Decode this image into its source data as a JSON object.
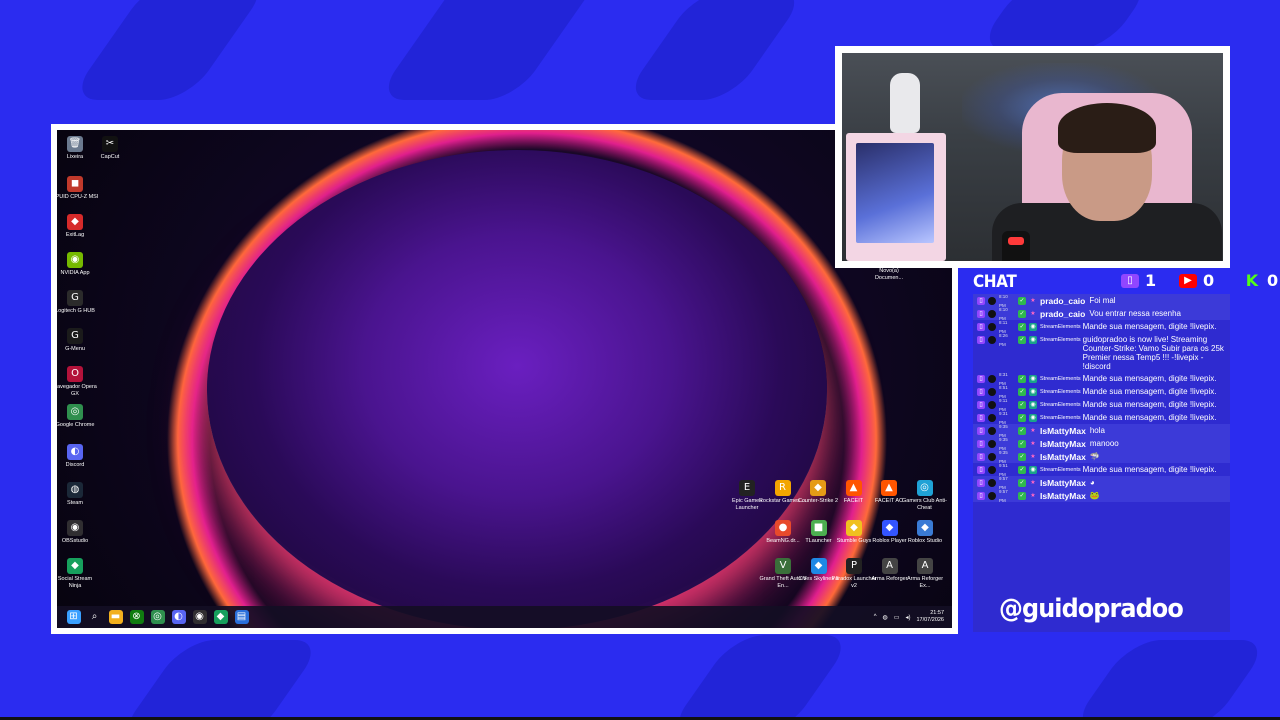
{
  "desktop": {
    "left_icons": [
      {
        "label": "Lixeira",
        "icon": "recycle-bin-icon",
        "glyph": "🗑",
        "color": "#6b7a8f"
      },
      {
        "label": "CPUID CPU-Z MSI",
        "icon": "cpuz-icon",
        "glyph": "◼",
        "color": "#c0392b"
      },
      {
        "label": "ExitLag",
        "icon": "exitlag-icon",
        "glyph": "◆",
        "color": "#d62a2a"
      },
      {
        "label": "NVIDIA App",
        "icon": "nvidia-icon",
        "glyph": "◉",
        "color": "#76b900"
      },
      {
        "label": "Logitech G HUB",
        "icon": "logitech-icon",
        "glyph": "G",
        "color": "#2b2b2b"
      },
      {
        "label": "G-Menu",
        "icon": "gmenu-icon",
        "glyph": "G",
        "color": "#1b1b1b"
      },
      {
        "label": "Navegador Opera GX",
        "icon": "opera-gx-icon",
        "glyph": "O",
        "color": "#b3123a"
      },
      {
        "label": "Google Chrome",
        "icon": "chrome-icon",
        "glyph": "◎",
        "color": "#2f8f4e"
      },
      {
        "label": "Discord",
        "icon": "discord-icon",
        "glyph": "◐",
        "color": "#5865f2"
      },
      {
        "label": "Steam",
        "icon": "steam-icon",
        "glyph": "◍",
        "color": "#1b2838"
      },
      {
        "label": "OBSstudio",
        "icon": "obs-icon",
        "glyph": "◉",
        "color": "#302e31"
      },
      {
        "label": "Social Stream Ninja",
        "icon": "social-stream-icon",
        "glyph": "◆",
        "color": "#17a05d"
      }
    ],
    "second_col_icons": [
      {
        "label": "CapCut",
        "icon": "capcut-icon",
        "glyph": "✂",
        "color": "#111111"
      }
    ],
    "right_icons_row1": [
      {
        "label": "Epic Games Launcher",
        "icon": "epic-games-icon",
        "glyph": "E",
        "color": "#222222"
      },
      {
        "label": "Rockstar Games ...",
        "icon": "rockstar-icon",
        "glyph": "R",
        "color": "#f3a500"
      },
      {
        "label": "Counter-Strike 2",
        "icon": "cs2-icon",
        "glyph": "◆",
        "color": "#e59b16"
      },
      {
        "label": "FACEIT",
        "icon": "faceit-icon",
        "glyph": "▲",
        "color": "#ff5500"
      },
      {
        "label": "FACEIT AC",
        "icon": "faceit-ac-icon",
        "glyph": "▲",
        "color": "#ff5500"
      },
      {
        "label": "Gamers Club Anti-Cheat",
        "icon": "gamers-club-icon",
        "glyph": "◎",
        "color": "#1fa2d6"
      }
    ],
    "right_icons_row2": [
      {
        "label": "BeamNG.dr...",
        "icon": "beamng-icon",
        "glyph": "●",
        "color": "#e84a2b"
      },
      {
        "label": "TLauncher",
        "icon": "tlauncher-icon",
        "glyph": "■",
        "color": "#4caf50"
      },
      {
        "label": "Stumble Guys",
        "icon": "stumble-guys-icon",
        "glyph": "◆",
        "color": "#f0c020"
      },
      {
        "label": "Roblox Player",
        "icon": "roblox-player-icon",
        "glyph": "◆",
        "color": "#3355ff"
      },
      {
        "label": "Roblox Studio",
        "icon": "roblox-studio-icon",
        "glyph": "◆",
        "color": "#3a7bd5"
      }
    ],
    "right_icons_row3": [
      {
        "label": "Grand Theft Auto V En...",
        "icon": "gta5-icon",
        "glyph": "V",
        "color": "#3a6f3a"
      },
      {
        "label": "Cities Skylines II",
        "icon": "cities-skylines-icon",
        "glyph": "◆",
        "color": "#1e88e5"
      },
      {
        "label": "Paradox Launcher v2",
        "icon": "paradox-icon",
        "glyph": "P",
        "color": "#222222"
      },
      {
        "label": "Arma Reforger",
        "icon": "arma-reforger-icon",
        "glyph": "A",
        "color": "#444444"
      },
      {
        "label": "Arma Reforger Ex...",
        "icon": "arma-reforger-ex-icon",
        "glyph": "A",
        "color": "#444444"
      }
    ],
    "doc_icon_label": "Novo(a) Documen...",
    "taskbar_icons": [
      {
        "name": "start-icon",
        "glyph": "⊞",
        "color": "#3aa0ff"
      },
      {
        "name": "search-icon",
        "glyph": "⌕",
        "color": "transparent"
      },
      {
        "name": "file-explorer-icon",
        "glyph": "▬",
        "color": "#f2b01e"
      },
      {
        "name": "xbox-icon",
        "glyph": "⊗",
        "color": "#107c10"
      },
      {
        "name": "chrome-taskbar-icon",
        "glyph": "◎",
        "color": "#2f8f4e"
      },
      {
        "name": "discord-taskbar-icon",
        "glyph": "◐",
        "color": "#5865f2"
      },
      {
        "name": "obs-taskbar-icon",
        "glyph": "◉",
        "color": "#302e31"
      },
      {
        "name": "social-stream-taskbar-icon",
        "glyph": "◆",
        "color": "#17a05d"
      },
      {
        "name": "notepad-taskbar-icon",
        "glyph": "▤",
        "color": "#2a6fdb"
      }
    ],
    "clock_time": "21:57",
    "clock_date": "17/07/2026"
  },
  "chat": {
    "title": "CHAT",
    "twitch_count": "1",
    "youtube_count": "0",
    "kick_count": "0",
    "colors": {
      "twitch": "#9146ff",
      "youtube": "#ff0000",
      "kick": "#53fc18"
    },
    "messages": [
      {
        "time": "8:10 PM",
        "user": "prado_caio",
        "small": false,
        "text": "Foi mal",
        "alt": true
      },
      {
        "time": "8:10 PM",
        "user": "prado_caio",
        "small": false,
        "text": "Vou entrar nessa resenha",
        "alt": true
      },
      {
        "time": "8:11 PM",
        "user": "StreamElements",
        "small": true,
        "text": "Mande sua mensagem, digite !livepix.",
        "alt": false
      },
      {
        "time": "8:26 PM",
        "user": "StreamElements",
        "small": true,
        "text": "guidopradoo is now live! Streaming Counter-Strike: Vamo Subir para os 25k Premier nessa Temp5 !!! -!livepix - !discord",
        "alt": false
      },
      {
        "time": "8:31 PM",
        "user": "StreamElements",
        "small": true,
        "text": "Mande sua mensagem, digite !livepix.",
        "alt": false
      },
      {
        "time": "8:51 PM",
        "user": "StreamElements",
        "small": true,
        "text": "Mande sua mensagem, digite !livepix.",
        "alt": false
      },
      {
        "time": "9:11 PM",
        "user": "StreamElements",
        "small": true,
        "text": "Mande sua mensagem, digite !livepix.",
        "alt": false
      },
      {
        "time": "9:31 PM",
        "user": "StreamElements",
        "small": true,
        "text": "Mande sua mensagem, digite !livepix.",
        "alt": false
      },
      {
        "time": "9:35 PM",
        "user": "IsMattyMax",
        "small": false,
        "text": "hola",
        "alt": true
      },
      {
        "time": "9:35 PM",
        "user": "IsMattyMax",
        "small": false,
        "text": "manooo",
        "alt": true
      },
      {
        "time": "9:35 PM",
        "user": "IsMattyMax",
        "small": false,
        "text": "🦈",
        "alt": true
      },
      {
        "time": "9:51 PM",
        "user": "StreamElements",
        "small": true,
        "text": "Mande sua mensagem, digite !livepix.",
        "alt": false
      },
      {
        "time": "9:57 PM",
        "user": "IsMattyMax",
        "small": false,
        "text": "◕",
        "alt": true
      },
      {
        "time": "9:57 PM",
        "user": "IsMattyMax",
        "small": false,
        "text": "🐸",
        "alt": true
      }
    ]
  },
  "overlay": {
    "handle": "@guidopradoo"
  }
}
